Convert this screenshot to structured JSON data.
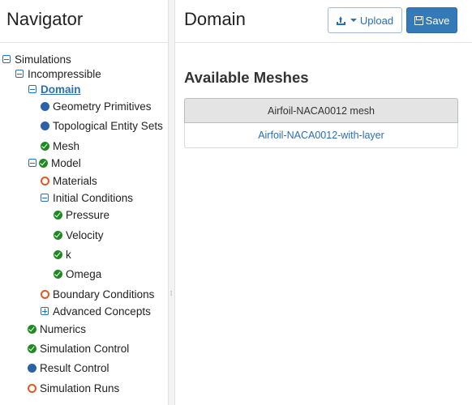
{
  "navigator": {
    "title": "Navigator",
    "tree": [
      {
        "label": "Simulations",
        "toggle": "minus",
        "status": "none"
      },
      {
        "label": "Incompressible",
        "toggle": "minus",
        "status": "none"
      },
      {
        "label": "Domain",
        "toggle": "minus",
        "status": "none",
        "active": true
      },
      {
        "label": "Geometry Primitives",
        "toggle": "none",
        "status": "blue"
      },
      {
        "label": "Topological Entity Sets",
        "toggle": "none",
        "status": "blue"
      },
      {
        "label": "Mesh",
        "toggle": "none",
        "status": "green"
      },
      {
        "label": "Model",
        "toggle": "minus",
        "status": "green"
      },
      {
        "label": "Materials",
        "toggle": "none",
        "status": "orange"
      },
      {
        "label": "Initial Conditions",
        "toggle": "minus",
        "status": "none"
      },
      {
        "label": "Pressure",
        "toggle": "none",
        "status": "green"
      },
      {
        "label": "Velocity",
        "toggle": "none",
        "status": "green"
      },
      {
        "label": "k",
        "toggle": "none",
        "status": "green"
      },
      {
        "label": "Omega",
        "toggle": "none",
        "status": "green"
      },
      {
        "label": "Boundary Conditions",
        "toggle": "none",
        "status": "orange"
      },
      {
        "label": "Advanced Concepts",
        "toggle": "plus",
        "status": "none"
      },
      {
        "label": "Numerics",
        "toggle": "none",
        "status": "green"
      },
      {
        "label": "Simulation Control",
        "toggle": "none",
        "status": "green"
      },
      {
        "label": "Result Control",
        "toggle": "none",
        "status": "blue"
      },
      {
        "label": "Simulation Runs",
        "toggle": "none",
        "status": "orange"
      }
    ]
  },
  "main": {
    "title": "Domain",
    "upload_label": "Upload",
    "save_label": "Save",
    "section_title": "Available Meshes",
    "mesh_header": "Airfoil-NACA0012 mesh",
    "mesh_items": [
      "Airfoil-NACA0012-with-layer"
    ]
  },
  "colors": {
    "accent": "#2a6fb5",
    "save_button": "#337ab7",
    "status_green": "#1f8a21",
    "status_blue": "#2a62a8",
    "status_orange": "#e2581f"
  },
  "icons": {
    "expanded": "minus-square-icon",
    "collapsed": "plus-square-icon",
    "complete": "check-circle-icon",
    "info": "filled-circle-icon",
    "incomplete": "empty-circle-icon",
    "upload": "upload-icon",
    "save": "floppy-disk-icon",
    "dropdown": "caret-down-icon"
  }
}
